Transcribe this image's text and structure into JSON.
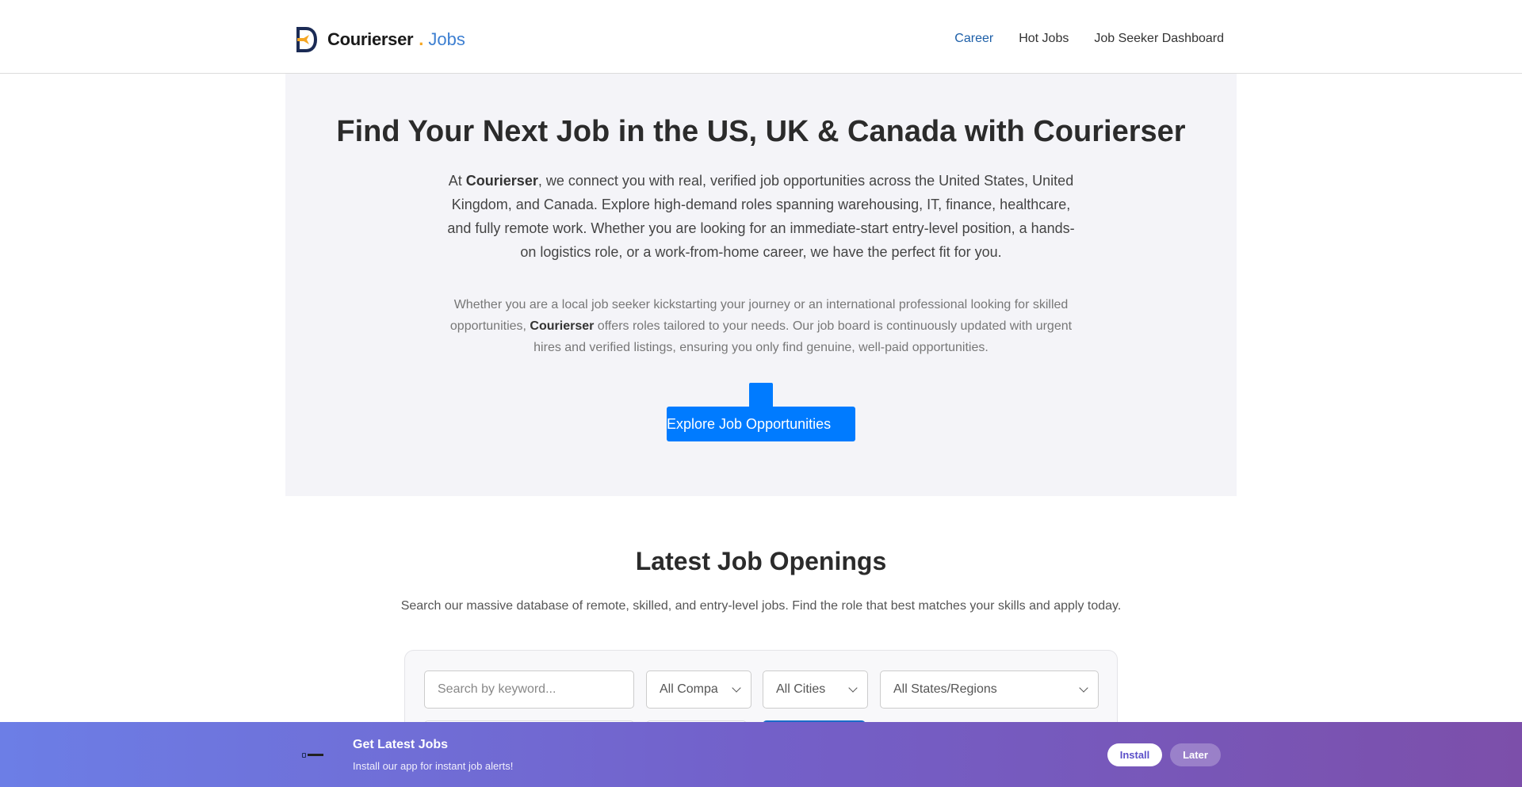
{
  "header": {
    "brand_name": "Courierser",
    "brand_dot": ".",
    "brand_suffix": "Jobs",
    "nav": [
      {
        "label": "Career"
      },
      {
        "label": "Hot Jobs"
      },
      {
        "label": "Job Seeker Dashboard"
      }
    ]
  },
  "hero": {
    "title": "Find Your Next Job in the US, UK & Canada with Courierser",
    "lead_prefix": "At ",
    "lead_brand": "Courierser",
    "lead_rest": ", we connect you with real, verified job opportunities across the United States, United Kingdom, and Canada. Explore high-demand roles spanning warehousing, IT, finance, healthcare, and fully remote work. Whether you are looking for an immediate-start entry-level position, a hands-on logistics role, or a work-from-home career, we have the perfect fit for you.",
    "sub_prefix": "Whether you are a local job seeker kickstarting your journey or an international professional looking for skilled opportunities, ",
    "sub_brand": "Courierser",
    "sub_rest": " offers roles tailored to your needs. Our job board is continuously updated with urgent hires and verified listings, ensuring you only find genuine, well-paid opportunities.",
    "cta_label": "Explore Job Opportunities"
  },
  "openings": {
    "title": "Latest Job Openings",
    "subtitle": "Search our massive database of remote, skilled, and entry-level jobs. Find the role that best matches your skills and apply today."
  },
  "filters": {
    "keyword_placeholder": "Search by keyword...",
    "company_selected": "All Compa",
    "city_selected": "All Cities",
    "state_selected": "All States/Regions"
  },
  "banner": {
    "title": "Get Latest Jobs",
    "subtitle": "Install our app for instant job alerts!",
    "install_label": "Install",
    "later_label": "Later"
  },
  "colors": {
    "primary": "#007bff",
    "brand_blue": "#3d7fd1",
    "brand_orange": "#f5a623",
    "nav_active": "#1d5fa8"
  }
}
